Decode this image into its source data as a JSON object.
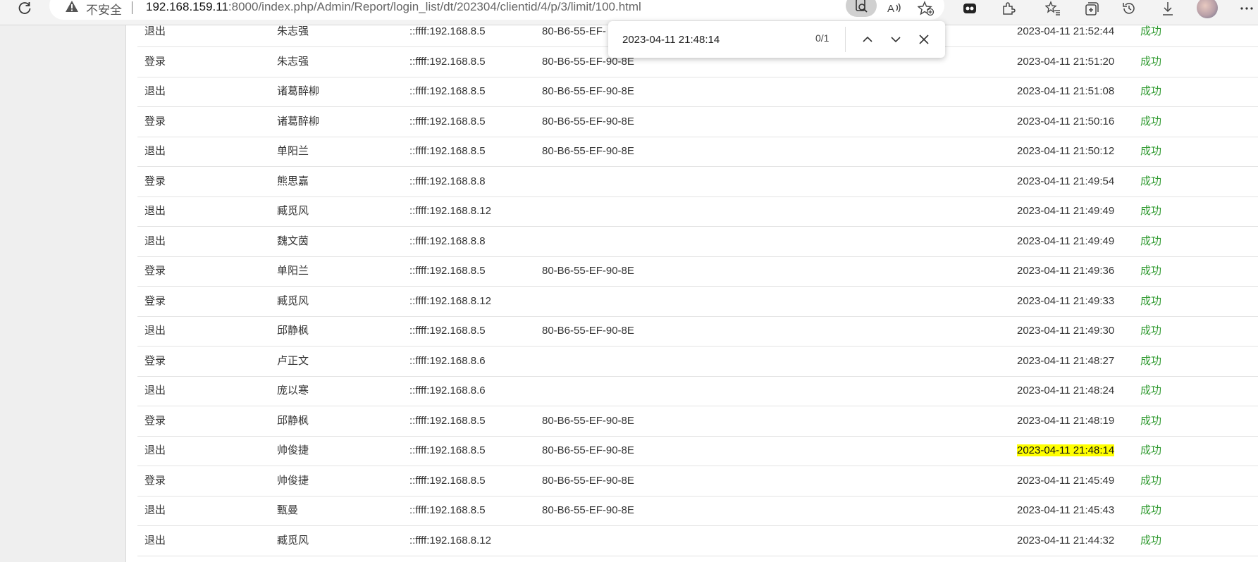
{
  "browser": {
    "insecure_label": "不安全",
    "url_host": "192.168.159.11",
    "url_rest": ":8000/index.php/Admin/Report/login_list/dt/202304/clientid/4/p/3/limit/100.html"
  },
  "find": {
    "query": "2023-04-11 21:48:14",
    "count": "0/1"
  },
  "rows": [
    {
      "action": "退出",
      "name": "朱志强",
      "ip": "::ffff:192.168.8.5",
      "mac": "80-B6-55-EF-",
      "time": "2023-04-11 21:52:44",
      "result": "成功"
    },
    {
      "action": "登录",
      "name": "朱志强",
      "ip": "::ffff:192.168.8.5",
      "mac": "80-B6-55-EF-90-8E",
      "time": "2023-04-11 21:51:20",
      "result": "成功"
    },
    {
      "action": "退出",
      "name": "诸葛醉柳",
      "ip": "::ffff:192.168.8.5",
      "mac": "80-B6-55-EF-90-8E",
      "time": "2023-04-11 21:51:08",
      "result": "成功"
    },
    {
      "action": "登录",
      "name": "诸葛醉柳",
      "ip": "::ffff:192.168.8.5",
      "mac": "80-B6-55-EF-90-8E",
      "time": "2023-04-11 21:50:16",
      "result": "成功"
    },
    {
      "action": "退出",
      "name": "单阳兰",
      "ip": "::ffff:192.168.8.5",
      "mac": "80-B6-55-EF-90-8E",
      "time": "2023-04-11 21:50:12",
      "result": "成功"
    },
    {
      "action": "登录",
      "name": "熊思嘉",
      "ip": "::ffff:192.168.8.8",
      "mac": "",
      "time": "2023-04-11 21:49:54",
      "result": "成功"
    },
    {
      "action": "退出",
      "name": "臧觅风",
      "ip": "::ffff:192.168.8.12",
      "mac": "",
      "time": "2023-04-11 21:49:49",
      "result": "成功"
    },
    {
      "action": "退出",
      "name": "魏文茵",
      "ip": "::ffff:192.168.8.8",
      "mac": "",
      "time": "2023-04-11 21:49:49",
      "result": "成功"
    },
    {
      "action": "登录",
      "name": "单阳兰",
      "ip": "::ffff:192.168.8.5",
      "mac": "80-B6-55-EF-90-8E",
      "time": "2023-04-11 21:49:36",
      "result": "成功"
    },
    {
      "action": "登录",
      "name": "臧觅风",
      "ip": "::ffff:192.168.8.12",
      "mac": "",
      "time": "2023-04-11 21:49:33",
      "result": "成功"
    },
    {
      "action": "退出",
      "name": "邱静枫",
      "ip": "::ffff:192.168.8.5",
      "mac": "80-B6-55-EF-90-8E",
      "time": "2023-04-11 21:49:30",
      "result": "成功"
    },
    {
      "action": "登录",
      "name": "卢正文",
      "ip": "::ffff:192.168.8.6",
      "mac": "",
      "time": "2023-04-11 21:48:27",
      "result": "成功"
    },
    {
      "action": "退出",
      "name": "庞以寒",
      "ip": "::ffff:192.168.8.6",
      "mac": "",
      "time": "2023-04-11 21:48:24",
      "result": "成功"
    },
    {
      "action": "登录",
      "name": "邱静枫",
      "ip": "::ffff:192.168.8.5",
      "mac": "80-B6-55-EF-90-8E",
      "time": "2023-04-11 21:48:19",
      "result": "成功"
    },
    {
      "action": "退出",
      "name": "帅俊捷",
      "ip": "::ffff:192.168.8.5",
      "mac": "80-B6-55-EF-90-8E",
      "time": "2023-04-11 21:48:14",
      "result": "成功",
      "highlight": true
    },
    {
      "action": "登录",
      "name": "帅俊捷",
      "ip": "::ffff:192.168.8.5",
      "mac": "80-B6-55-EF-90-8E",
      "time": "2023-04-11 21:45:49",
      "result": "成功"
    },
    {
      "action": "退出",
      "name": "甄曼",
      "ip": "::ffff:192.168.8.5",
      "mac": "80-B6-55-EF-90-8E",
      "time": "2023-04-11 21:45:43",
      "result": "成功"
    },
    {
      "action": "退出",
      "name": "臧觅风",
      "ip": "::ffff:192.168.8.12",
      "mac": "",
      "time": "2023-04-11 21:44:32",
      "result": "成功"
    }
  ],
  "colors": {
    "success": "#2f9a2f",
    "highlight": "#ffff00"
  }
}
